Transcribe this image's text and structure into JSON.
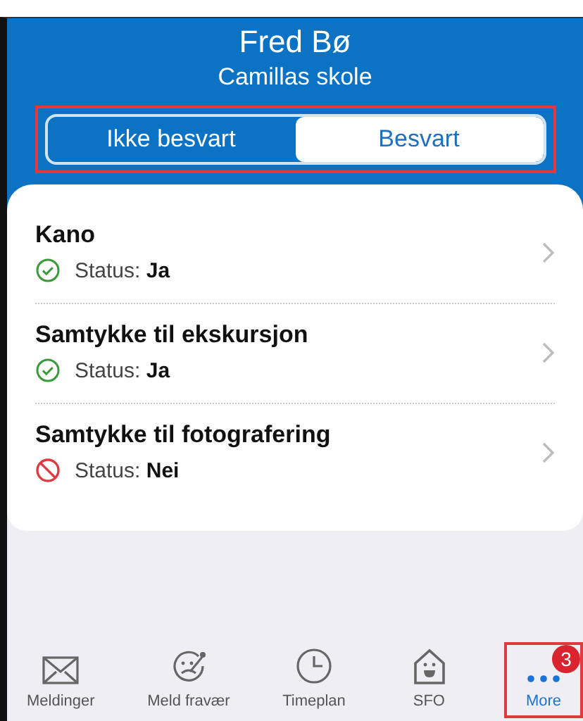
{
  "header": {
    "title": "Fred Bø",
    "subtitle": "Camillas skole"
  },
  "segments": {
    "highlighted": true,
    "items": [
      {
        "label": "Ikke besvart",
        "selected": false
      },
      {
        "label": "Besvart",
        "selected": true
      }
    ]
  },
  "items": [
    {
      "title": "Kano",
      "kind": "yes",
      "status": "Status: **Ja**"
    },
    {
      "title": "Samtykke til ekskursjon",
      "kind": "yes",
      "status": "Status: **Ja**"
    },
    {
      "title": "Samtykke til fotografering",
      "kind": "no",
      "status": "Status: **Nei**"
    }
  ],
  "tab_bar": [
    {
      "label": "Meldinger",
      "kind": "mail",
      "selected": false,
      "highlighted": false
    },
    {
      "label": "Meld fravær",
      "kind": "absence",
      "selected": false,
      "highlighted": false
    },
    {
      "label": "Timeplan",
      "kind": "clock",
      "selected": false,
      "highlighted": false
    },
    {
      "label": "SFO",
      "kind": "house",
      "selected": false,
      "highlighted": false
    },
    {
      "label": "More",
      "kind": "more",
      "selected": true,
      "highlighted": true,
      "badge": "3"
    }
  ]
}
